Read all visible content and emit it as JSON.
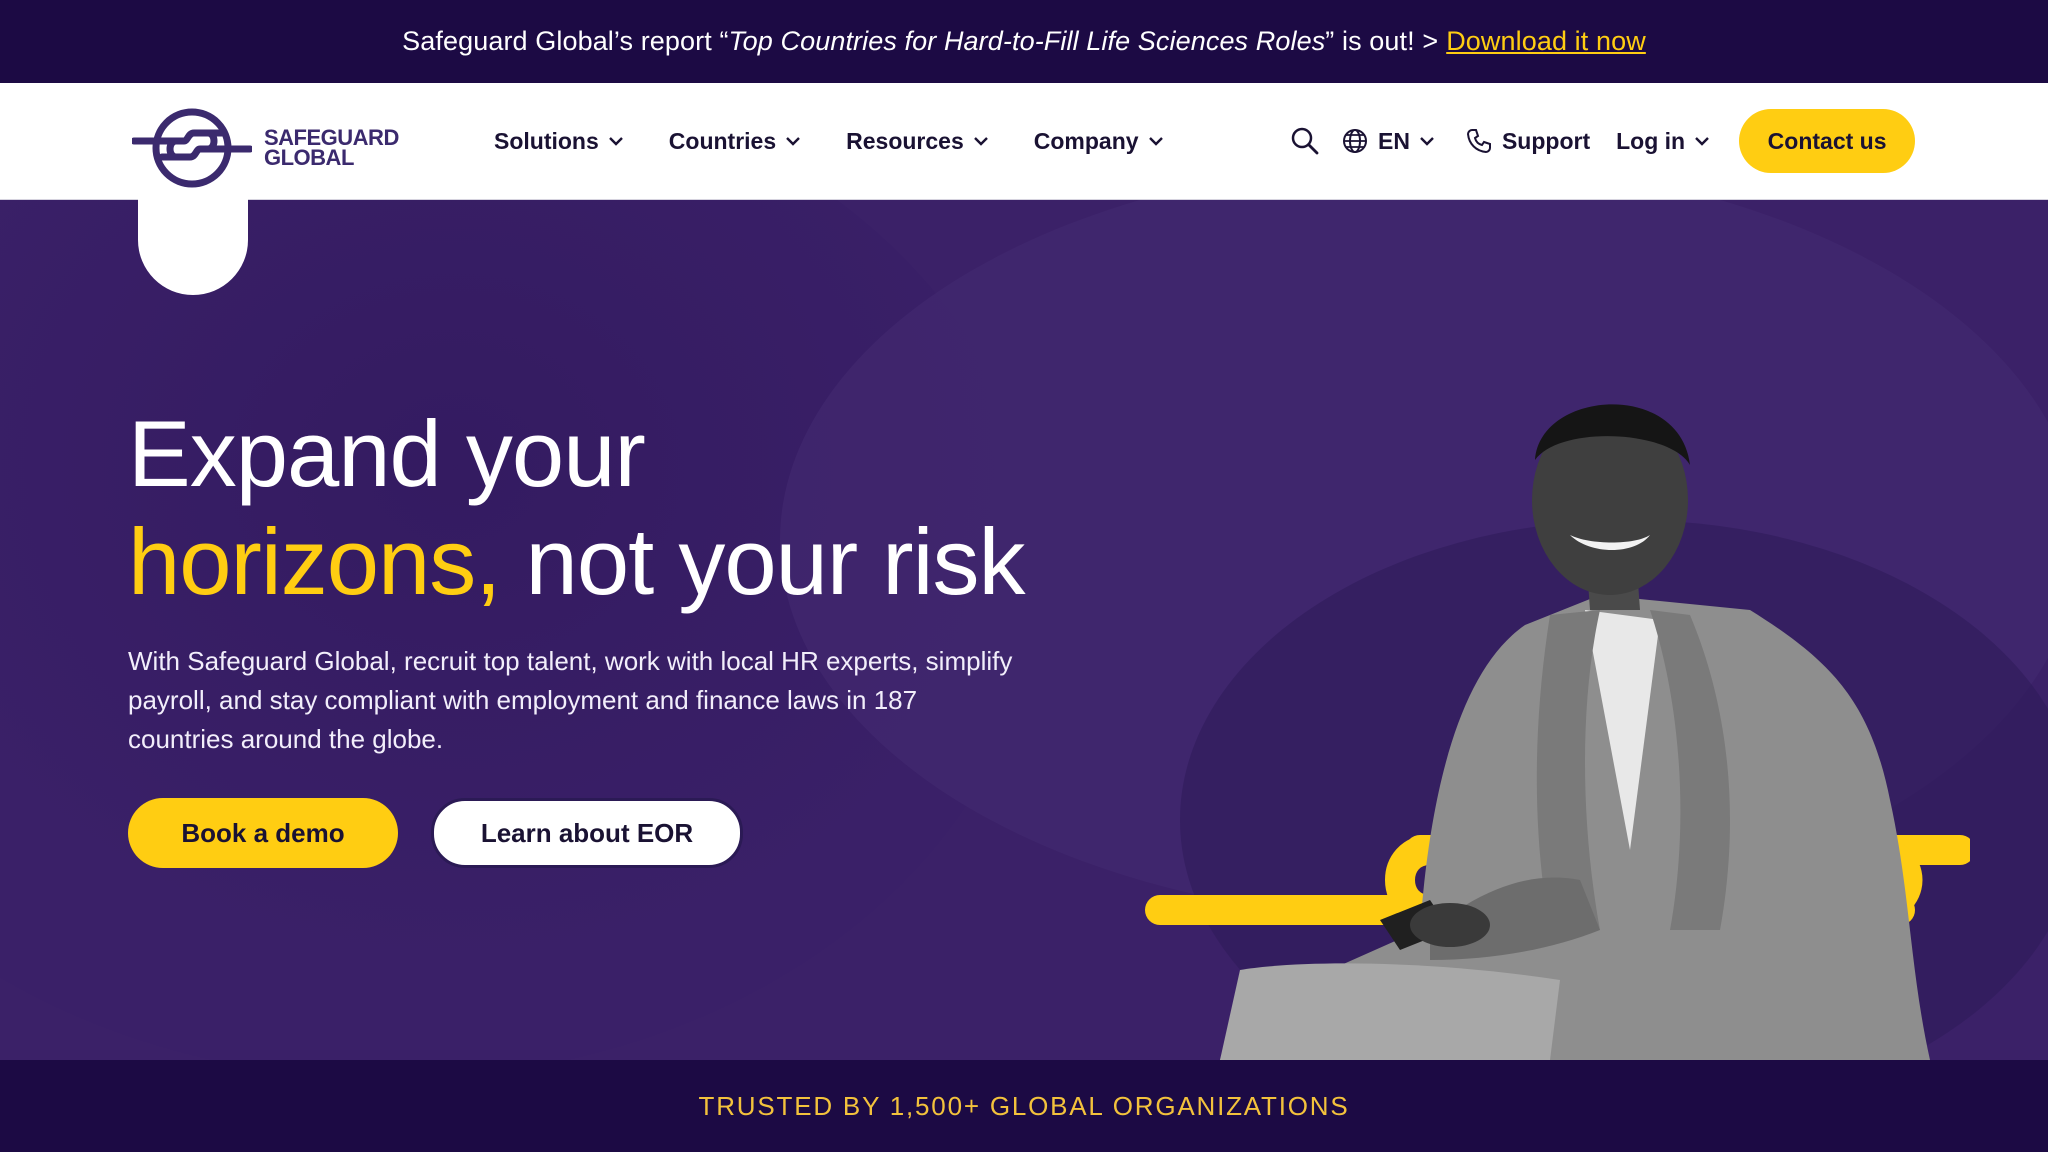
{
  "promo": {
    "prefix": "Safeguard Global’s report “",
    "report_title": "Top Countries for Hard-to-Fill Life Sciences Roles",
    "suffix": "” is out! >",
    "link_label": "Download it now"
  },
  "nav": {
    "logo": {
      "line1": "SAFEGUARD",
      "line2": "GLOBAL"
    },
    "menu": [
      {
        "label": "Solutions"
      },
      {
        "label": "Countries"
      },
      {
        "label": "Resources"
      },
      {
        "label": "Company"
      }
    ],
    "language": "EN",
    "support_label": "Support",
    "login_label": "Log in",
    "contact_label": "Contact us"
  },
  "hero": {
    "headline_line1": "Expand your",
    "headline_accent": "horizons,",
    "headline_rest": " not your risk",
    "subtext": "With Safeguard Global, recruit top talent, work with local HR experts, simplify payroll, and stay compliant with employment and finance laws in 187 countries around the globe.",
    "primary_cta": "Book a demo",
    "secondary_cta": "Learn about EOR"
  },
  "trust": {
    "label": "TRUSTED BY 1,500+ GLOBAL ORGANIZATIONS"
  },
  "colors": {
    "brand_purple": "#3b2168",
    "dark_purple": "#1c0a44",
    "accent_yellow": "#ffcd12",
    "logo_purple": "#3b2a6e"
  },
  "icons": [
    "safeguard-logo-icon",
    "chevron-down-icon",
    "search-icon",
    "globe-icon",
    "phone-icon"
  ]
}
